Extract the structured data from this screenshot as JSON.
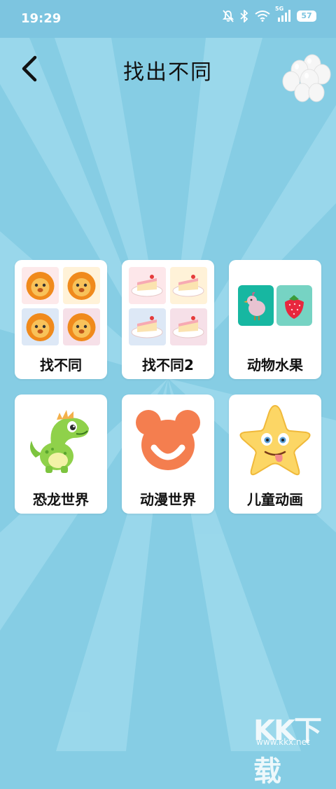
{
  "status_bar": {
    "time": "19:29",
    "network_label": "5G",
    "battery_level": "57",
    "icons": [
      "mute-bell-icon",
      "bluetooth-icon",
      "wifi-icon",
      "signal-icon",
      "battery-icon"
    ]
  },
  "header": {
    "title": "找出不同",
    "back_icon": "chevron-left-icon",
    "decoration_icon": "balloons-icon"
  },
  "games": [
    {
      "label": "找不同",
      "icon": "lion-tiles"
    },
    {
      "label": "找不同2",
      "icon": "cake-tiles"
    },
    {
      "label": "动物水果",
      "icon": "bird-strawberry-tiles"
    },
    {
      "label": "恐龙世界",
      "icon": "dinosaur-icon"
    },
    {
      "label": "动漫世界",
      "icon": "bear-face-icon"
    },
    {
      "label": "儿童动画",
      "icon": "star-face-icon"
    }
  ],
  "watermark": {
    "text": "KK下载",
    "url": "www.kkx.net"
  },
  "colors": {
    "background": "#86cde4",
    "ray": "#9fdbee",
    "card": "#ffffff",
    "bear": "#f47e4f",
    "star": "#fcd665"
  }
}
